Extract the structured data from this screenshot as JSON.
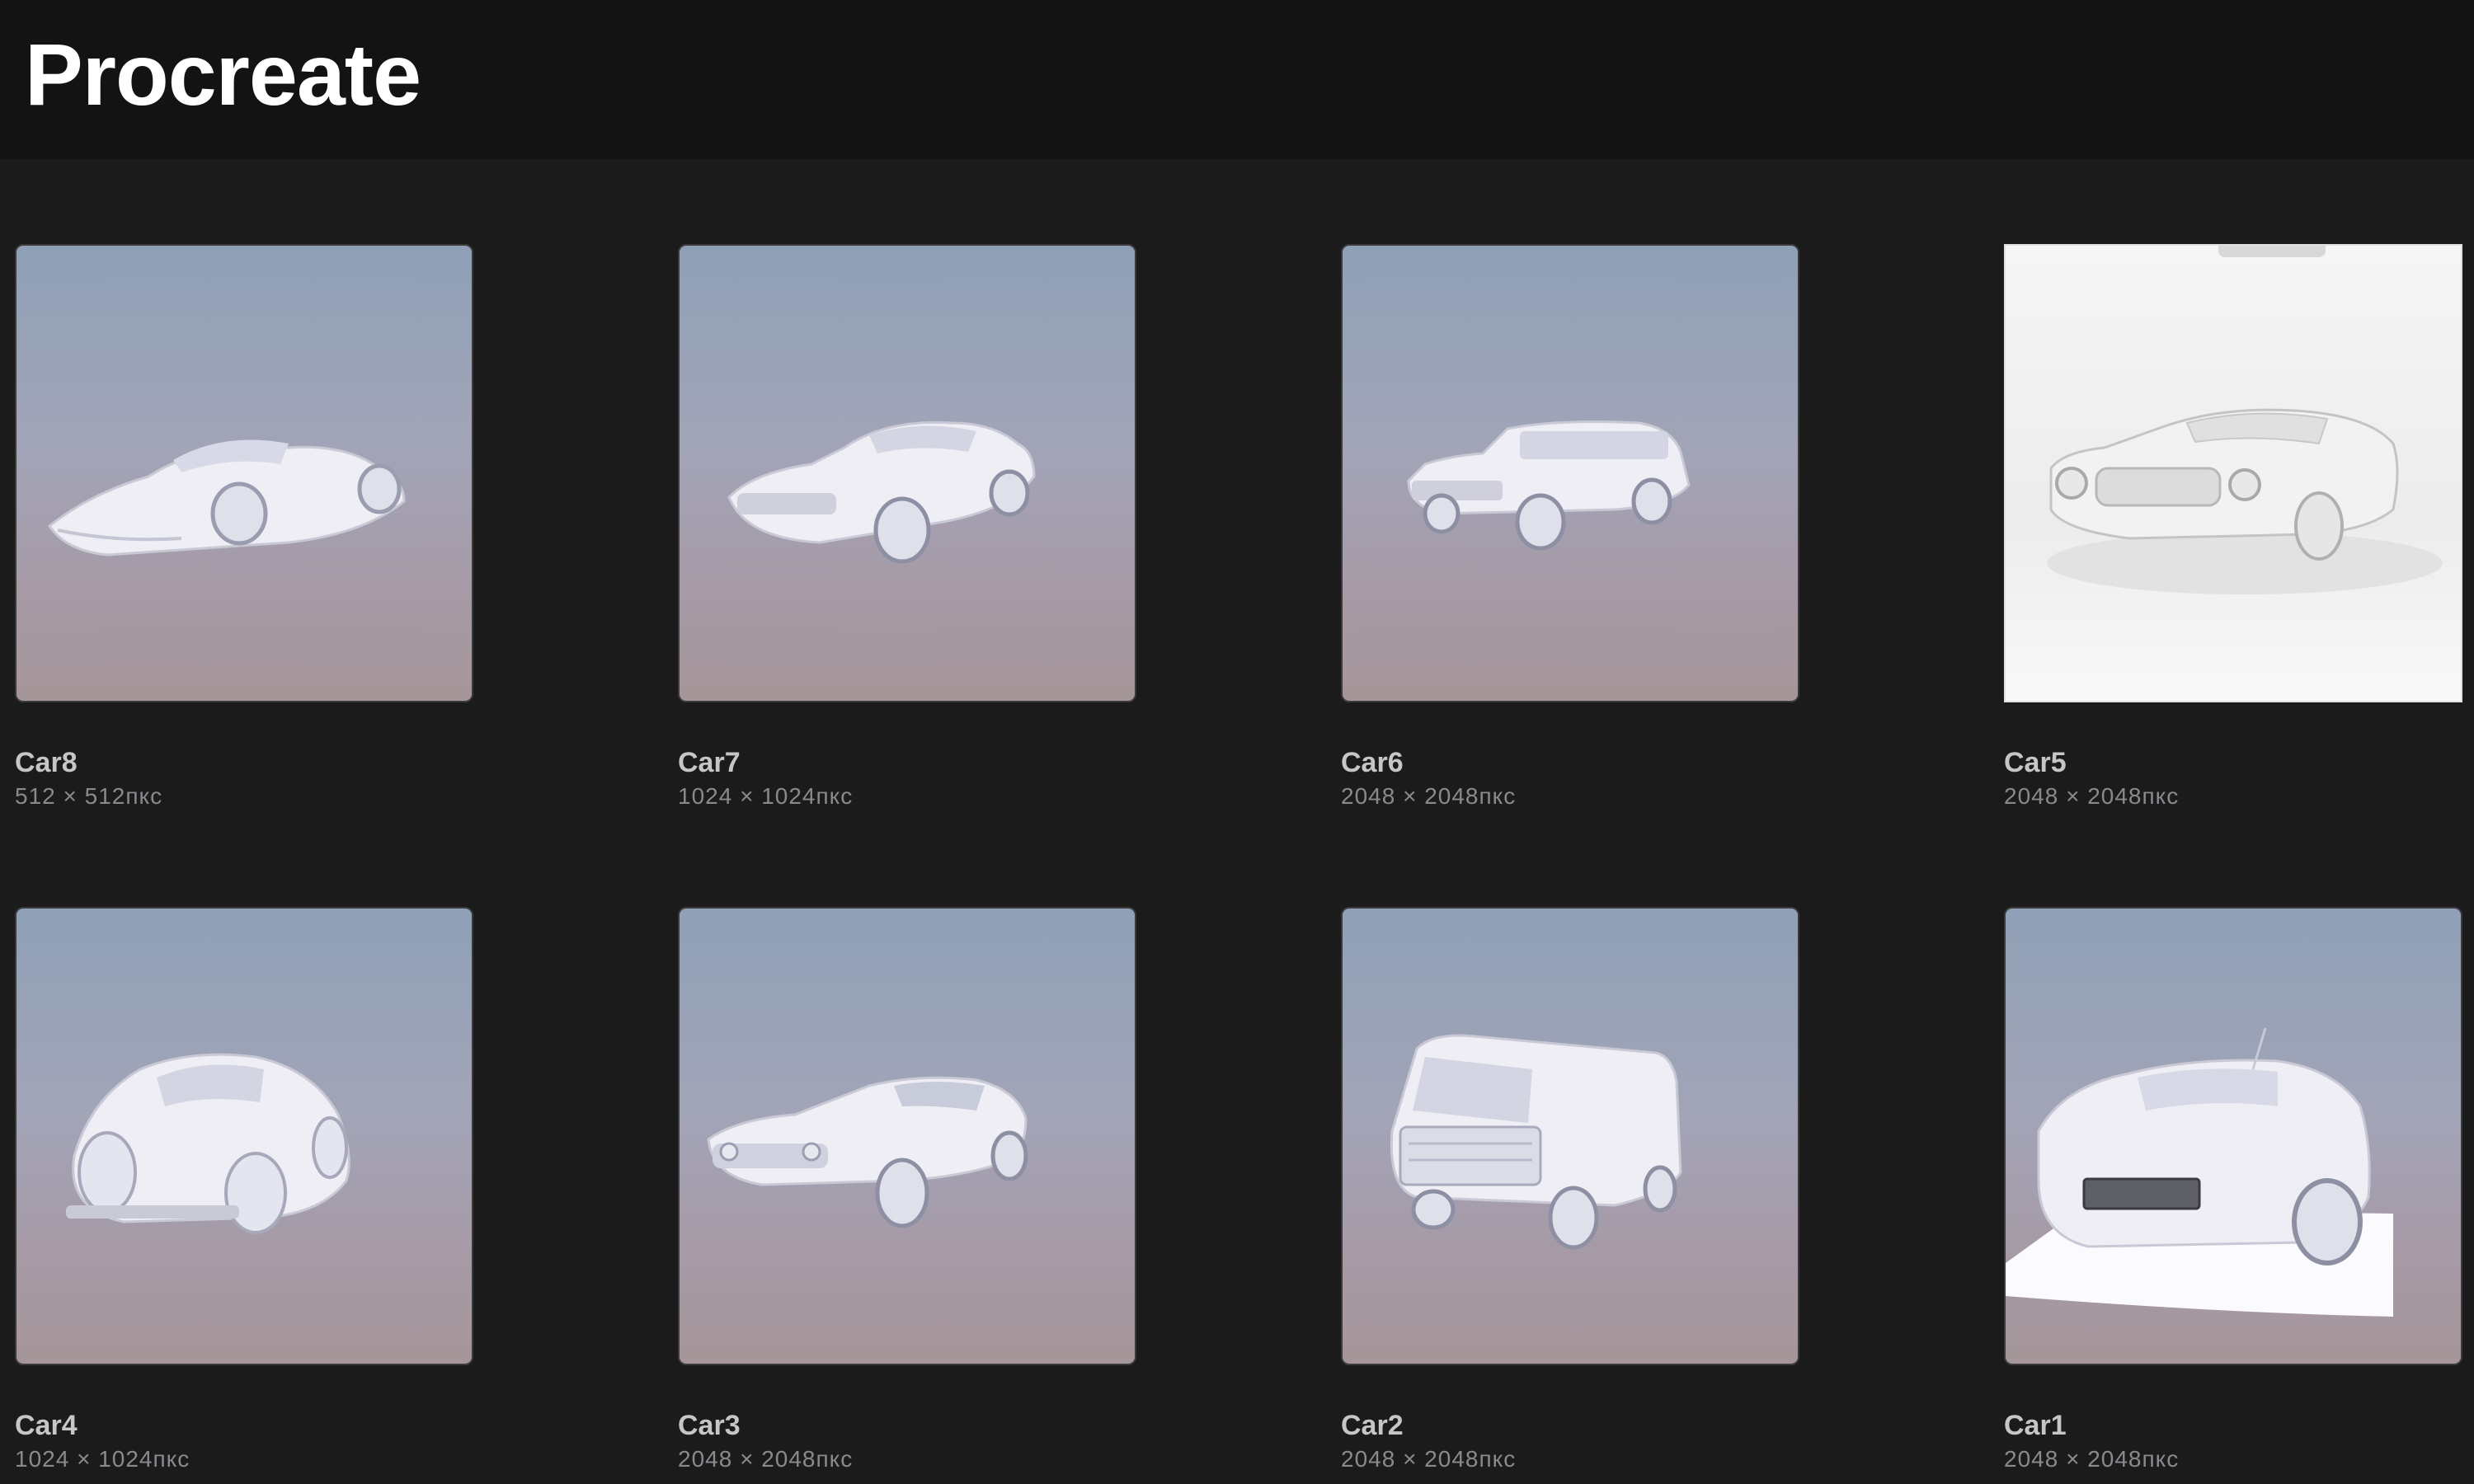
{
  "app": {
    "title": "Procreate"
  },
  "gallery": {
    "artworks": [
      {
        "name": "Car8",
        "size": "512 × 512пкс",
        "icon": "sports-car-icon"
      },
      {
        "name": "Car7",
        "size": "1024 × 1024пкс",
        "icon": "muscle-car-icon"
      },
      {
        "name": "Car6",
        "size": "2048 × 2048пкс",
        "icon": "station-wagon-icon"
      },
      {
        "name": "Car5",
        "size": "2048 × 2048пкс",
        "icon": "classic-coupe-icon"
      },
      {
        "name": "Car4",
        "size": "1024 × 1024пкс",
        "icon": "beetle-car-icon"
      },
      {
        "name": "Car3",
        "size": "2048 × 2048пкс",
        "icon": "fastback-car-icon"
      },
      {
        "name": "Car2",
        "size": "2048 × 2048пкс",
        "icon": "van-icon"
      },
      {
        "name": "Car1",
        "size": "2048 × 2048пкс",
        "icon": "hatchback-car-icon"
      }
    ]
  },
  "colors": {
    "header_bg": "#131313",
    "gallery_bg": "#1b1b1b",
    "title_text": "#ffffff",
    "thumb_gradient_top": "#8fa0b6",
    "thumb_gradient_bottom": "#a59699"
  }
}
